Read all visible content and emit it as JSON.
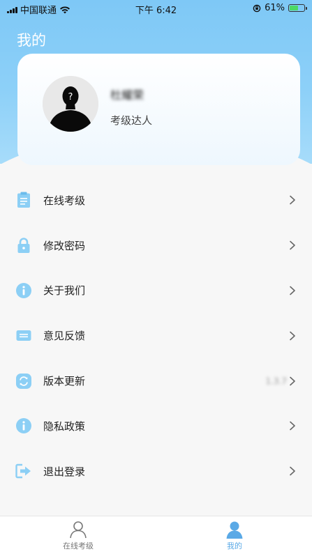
{
  "status_bar": {
    "carrier": "中国联通",
    "time": "下午 6:42",
    "battery": "61%",
    "battery_level": 0.61
  },
  "header": {
    "title": "我的"
  },
  "profile": {
    "name": "杜耀荣",
    "title": "考级达人"
  },
  "menu": [
    {
      "label": "在线考级",
      "icon": "clipboard-icon"
    },
    {
      "label": "修改密码",
      "icon": "lock-icon"
    },
    {
      "label": "关于我们",
      "icon": "info-icon"
    },
    {
      "label": "意见反馈",
      "icon": "feedback-icon"
    },
    {
      "label": "版本更新",
      "icon": "refresh-icon",
      "value": "1.3.7"
    },
    {
      "label": "隐私政策",
      "icon": "info-icon"
    },
    {
      "label": "退出登录",
      "icon": "logout-icon"
    }
  ],
  "tab_bar": {
    "tabs": [
      {
        "label": "在线考级",
        "icon": "user-outline-icon",
        "active": false
      },
      {
        "label": "我的",
        "icon": "user-filled-icon",
        "active": true
      }
    ]
  },
  "colors": {
    "accent": "#5aa9e6",
    "header_gradient_top": "#7ec8f6",
    "icon_blue": "#8ccff5"
  }
}
